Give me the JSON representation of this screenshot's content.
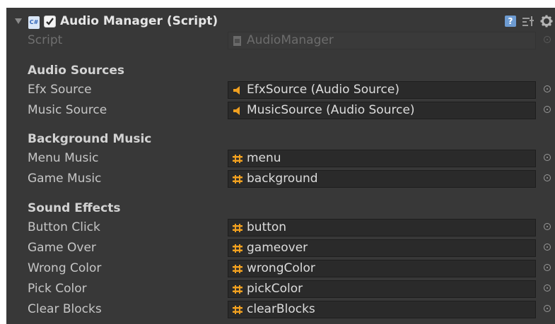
{
  "component": {
    "title": "Audio Manager (Script)",
    "script_label": "Script",
    "script_value": "AudioManager"
  },
  "sections": [
    {
      "title": "Audio Sources",
      "fields": [
        {
          "label": "Efx Source",
          "value": "EfxSource (Audio Source)",
          "icon": "audio-source-icon"
        },
        {
          "label": "Music Source",
          "value": "MusicSource (Audio Source)",
          "icon": "audio-source-icon"
        }
      ]
    },
    {
      "title": "Background Music",
      "fields": [
        {
          "label": "Menu Music",
          "value": "menu",
          "icon": "audio-clip-icon"
        },
        {
          "label": "Game Music",
          "value": "background",
          "icon": "audio-clip-icon"
        }
      ]
    },
    {
      "title": "Sound Effects",
      "fields": [
        {
          "label": "Button Click",
          "value": "button",
          "icon": "audio-clip-icon"
        },
        {
          "label": "Game Over",
          "value": "gameover",
          "icon": "audio-clip-icon"
        },
        {
          "label": "Wrong Color",
          "value": "wrongColor",
          "icon": "audio-clip-icon"
        },
        {
          "label": "Pick Color",
          "value": "pickColor",
          "icon": "audio-clip-icon"
        },
        {
          "label": "Clear Blocks",
          "value": "clearBlocks",
          "icon": "audio-clip-icon"
        }
      ]
    }
  ],
  "colors": {
    "panel_bg": "#383838",
    "field_bg": "#2a2a2a",
    "accent_orange": "#f0a020",
    "text": "#c6c6c6"
  }
}
